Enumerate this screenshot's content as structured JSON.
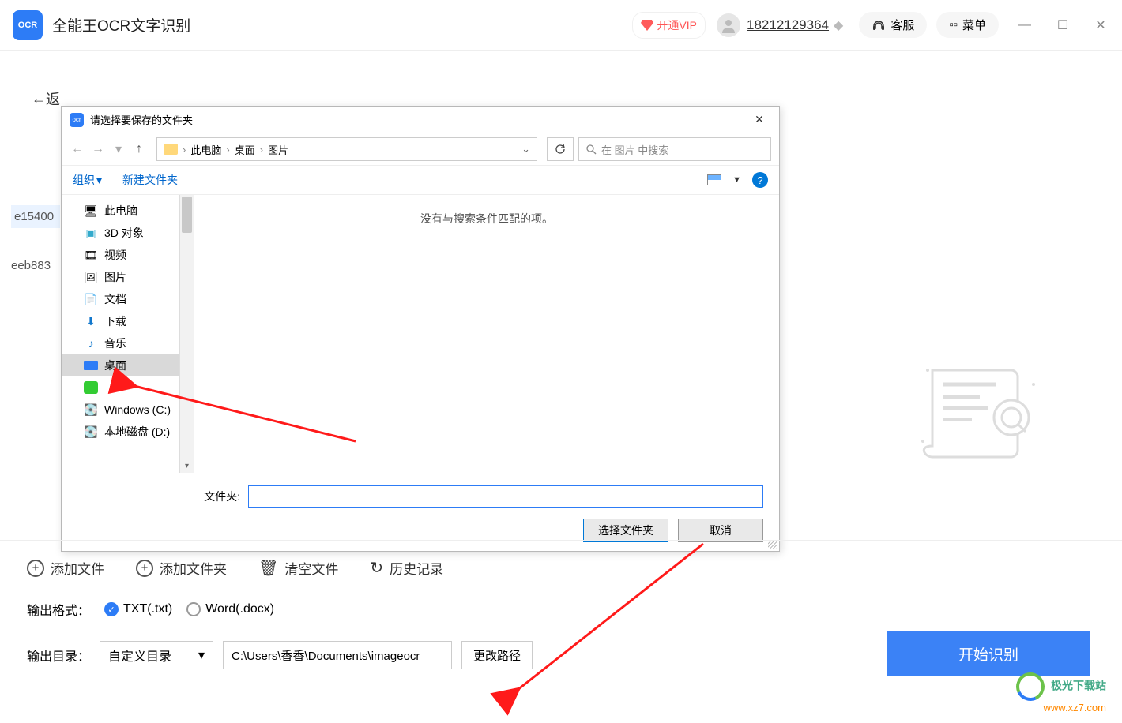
{
  "titlebar": {
    "app_name": "全能王OCR文字识别",
    "vip_label": "开通VIP",
    "phone": "18212129364",
    "service_label": "客服",
    "menu_label": "菜单"
  },
  "back_label": "返",
  "file_rows": [
    "e15400",
    "eeb883"
  ],
  "dialog": {
    "title": "请选择要保存的文件夹",
    "breadcrumb": [
      "此电脑",
      "桌面",
      "图片"
    ],
    "search_placeholder": "在 图片 中搜索",
    "toolbar_organize": "组织",
    "toolbar_newfolder": "新建文件夹",
    "tree": [
      {
        "label": "此电脑",
        "icon": "pc"
      },
      {
        "label": "3D 对象",
        "icon": "3d"
      },
      {
        "label": "视频",
        "icon": "video"
      },
      {
        "label": "图片",
        "icon": "image"
      },
      {
        "label": "文档",
        "icon": "doc"
      },
      {
        "label": "下载",
        "icon": "download"
      },
      {
        "label": "音乐",
        "icon": "music"
      },
      {
        "label": "桌面",
        "icon": "desktop",
        "selected": true
      },
      {
        "label": "",
        "icon": "iqiyi"
      },
      {
        "label": "Windows (C:)",
        "icon": "drive"
      },
      {
        "label": "本地磁盘 (D:)",
        "icon": "drive"
      }
    ],
    "empty_msg": "没有与搜索条件匹配的项。",
    "folder_label": "文件夹:",
    "folder_value": "",
    "btn_select": "选择文件夹",
    "btn_cancel": "取消"
  },
  "actions": {
    "add_file": "添加文件",
    "add_folder": "添加文件夹",
    "clear": "清空文件",
    "history": "历史记录"
  },
  "format": {
    "label": "输出格式：",
    "txt": "TXT(.txt)",
    "word": "Word(.docx)"
  },
  "output": {
    "label": "输出目录：",
    "mode": "自定义目录",
    "path": "C:\\Users\\香香\\Documents\\imageocr",
    "change": "更改路径"
  },
  "start_label": "开始识别",
  "watermark": {
    "line1": "极光下载站",
    "line2": "www.xz7.com"
  }
}
